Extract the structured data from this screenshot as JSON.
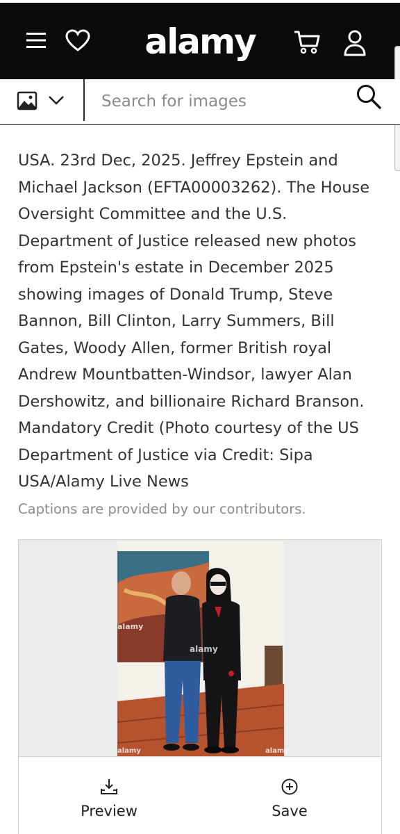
{
  "header": {
    "logo_text": "alamy",
    "icons": [
      "menu-icon",
      "heart-icon",
      "cart-icon",
      "user-icon"
    ]
  },
  "search": {
    "type_icon": "image-icon",
    "placeholder": "Search for images",
    "value": ""
  },
  "caption": {
    "text": "USA. 23rd Dec, 2025. Jeffrey Epstein and Michael Jackson (EFTA00003262). The House Oversight Committee and the U.S. Department of Justice released new photos from Epstein's estate in December 2025 showing images of Donald Trump, Steve Bannon, Bill Clinton, Larry Summers, Bill Gates, Woody Allen, former British royal Andrew Mountbatten-Windsor, lawyer Alan Dershowitz, and billionaire Richard Branson. Mandatory Credit (Photo courtesy of the US Department of Justice via Credit: Sipa USA/Alamy Live News",
    "note": "Captions are provided by our contributors."
  },
  "image_card": {
    "watermark": "alamy",
    "actions": {
      "preview_label": "Preview",
      "save_label": "Save"
    }
  },
  "colors": {
    "header_bg": "#0b0b0b",
    "text": "#333333",
    "muted": "#8c8c8c"
  }
}
